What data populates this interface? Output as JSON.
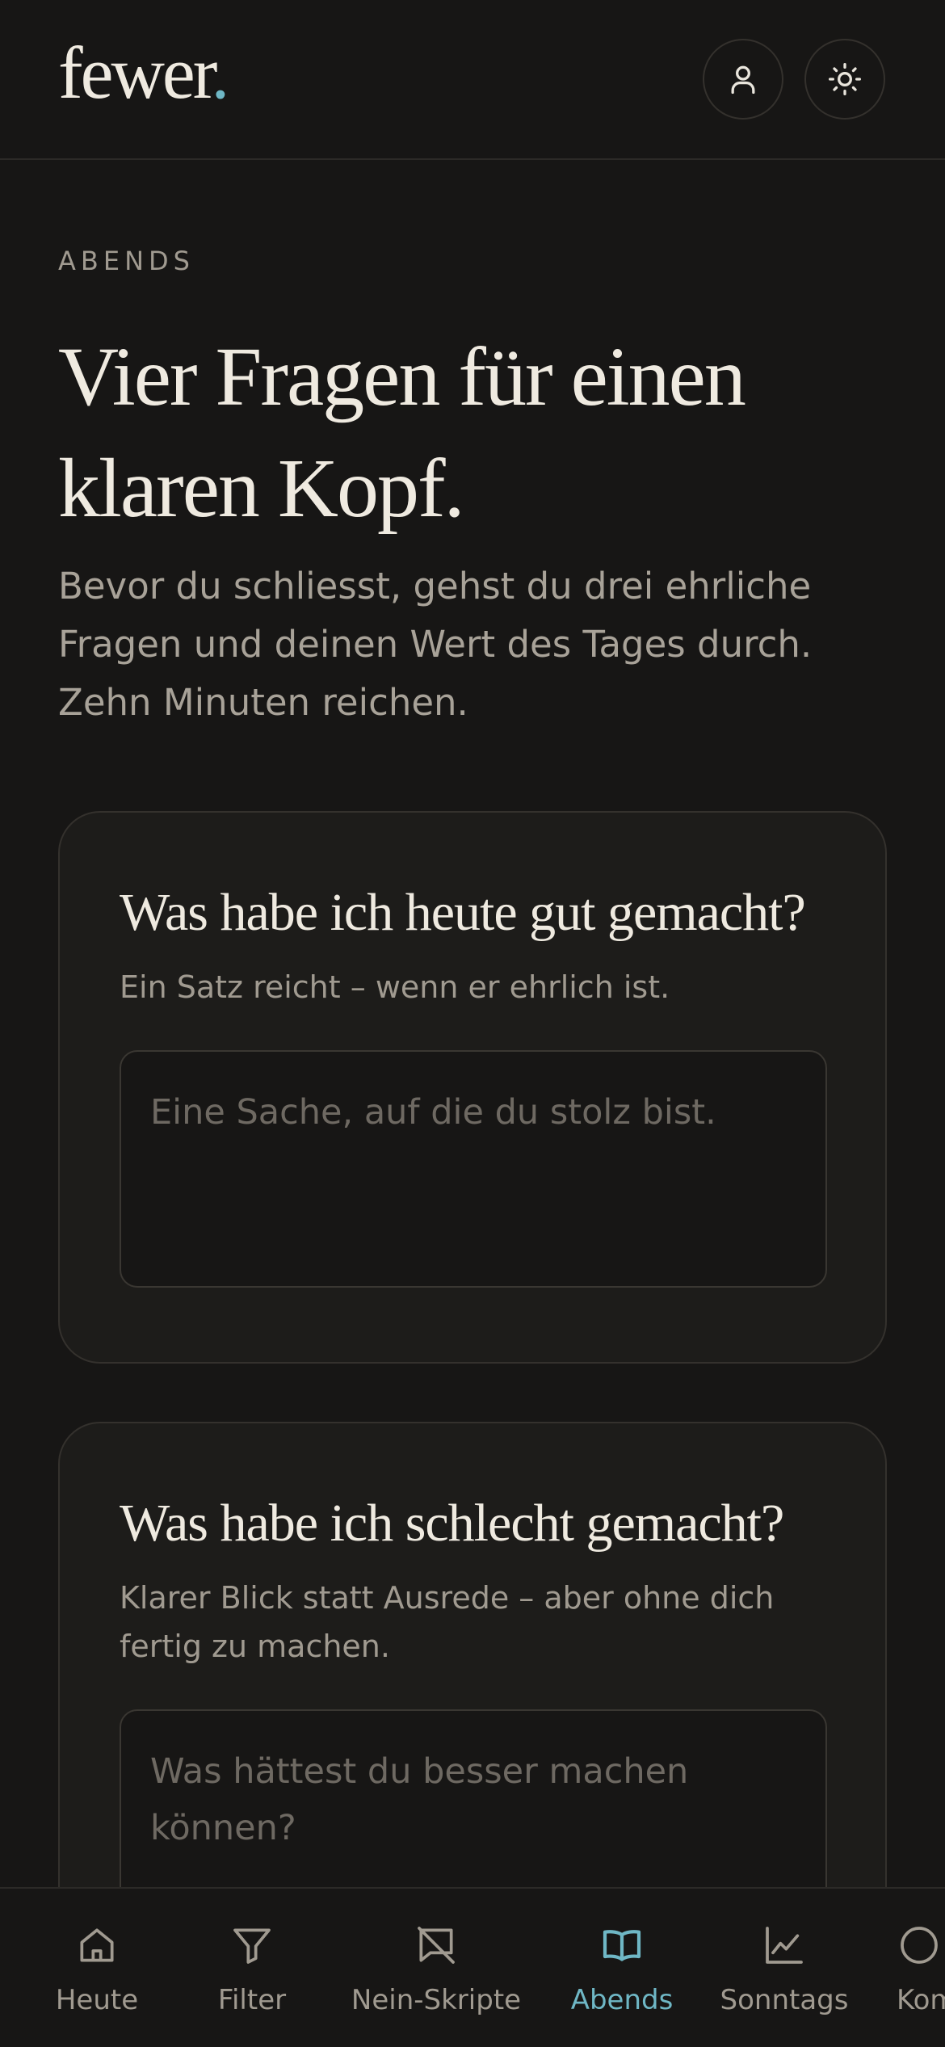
{
  "app": {
    "logo_text": "fewer",
    "logo_dot": ".",
    "accent": "#6fb7c5"
  },
  "header": {
    "icons": [
      "user-icon",
      "sun-icon"
    ]
  },
  "page": {
    "eyebrow": "ABENDS",
    "title": "Vier Fragen für einen klaren Kopf.",
    "intro": "Bevor du schliesst, gehst du drei ehrliche Fragen und deinen Wert des Tages durch. Zehn Minuten reichen."
  },
  "questions": [
    {
      "title": "Was habe ich heute gut gemacht?",
      "subtitle": "Ein Satz reicht – wenn er ehrlich ist.",
      "placeholder": "Eine Sache, auf die du stolz bist.",
      "value": ""
    },
    {
      "title": "Was habe ich schlecht gemacht?",
      "subtitle": "Klarer Blick statt Ausrede – aber ohne dich fertig zu machen.",
      "placeholder": "Was hättest du besser machen können?",
      "value": ""
    }
  ],
  "nav": {
    "items": [
      {
        "label": "Heute",
        "icon": "home-icon",
        "active": false
      },
      {
        "label": "Filter",
        "icon": "filter-icon",
        "active": false
      },
      {
        "label": "Nein-Skripte",
        "icon": "message-off-icon",
        "active": false
      },
      {
        "label": "Abends",
        "icon": "book-open-icon",
        "active": true
      },
      {
        "label": "Sonntags",
        "icon": "chart-line-icon",
        "active": false
      },
      {
        "label": "Kompass",
        "icon": "compass-icon",
        "active": false
      }
    ]
  }
}
